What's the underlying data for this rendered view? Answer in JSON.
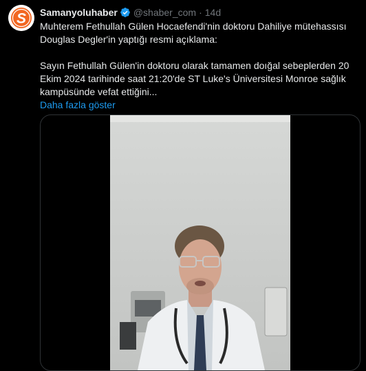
{
  "tweet": {
    "author_name": "Samanyoluhaber",
    "handle": "@shaber_com",
    "separator": "·",
    "time": "14d",
    "text": "Muhterem Fethullah Gülen Hocaefendi'nin doktoru Dahiliye mütehassısı Douglas Degler'in yaptığı resmi açıklama:\n\nSayın Fethullah Gülen'in doktoru olarak tamamen doığal sebeplerden 20 Ekim 2024 tarihinde saat 21:20'de ST Luke's Üniversitesi Monroe sağlık kampüsünde vefat ettiğini...",
    "show_more": "Daha fazla göster"
  },
  "colors": {
    "background": "#000000",
    "text": "#e7e9ea",
    "muted": "#71767b",
    "link": "#1d9bf0",
    "verified": "#1d9bf0",
    "avatar_brand": "#f26722"
  },
  "icons": {
    "verified": "verified-badge-icon",
    "avatar": "samanyoluhaber-logo"
  },
  "media": {
    "type": "video"
  }
}
